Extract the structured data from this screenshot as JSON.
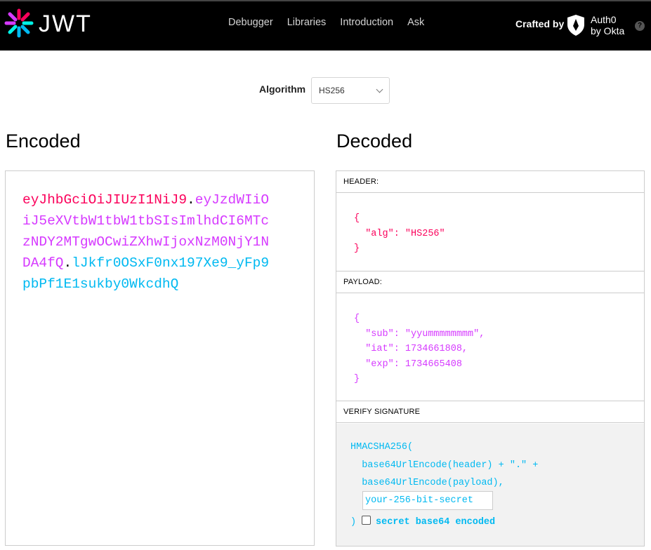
{
  "header": {
    "logo_text": "JWT",
    "nav": [
      {
        "label": "Debugger"
      },
      {
        "label": "Libraries"
      },
      {
        "label": "Introduction"
      },
      {
        "label": "Ask"
      }
    ],
    "crafted_by": "Crafted by",
    "auth0_line1": "Auth0",
    "auth0_line2": "by Okta",
    "help": "?"
  },
  "algorithm": {
    "label": "Algorithm",
    "selected": "HS256"
  },
  "encoded": {
    "title": "Encoded",
    "header_part": "eyJhbGciOiJIUzI1NiJ9",
    "payload_part": "eyJzdWIiOiJ5eXVtbW1tbW1tbSIsImlhdCI6MTczNDY2MTgwOCwiZXhwIjoxNzM0NjY1NDA4fQ",
    "signature_part": "lJkfr0OSxF0nx197Xe9_yFp9pbPf1E1sukby0WkcdhQ",
    "dot": "."
  },
  "decoded": {
    "title": "Decoded",
    "header_label": "HEADER:",
    "header_lines": [
      "{",
      "  \"alg\": \"HS256\"",
      "}"
    ],
    "payload_label": "PAYLOAD:",
    "payload_lines": [
      "{",
      "  \"sub\": \"yyummmmmmmm\",",
      "  \"iat\": 1734661808,",
      "  \"exp\": 1734665408",
      "}"
    ],
    "verify_label": "VERIFY SIGNATURE",
    "verify_lines": [
      "HMACSHA256(",
      "  base64UrlEncode(header) + \".\" +",
      "  base64UrlEncode(payload),"
    ],
    "secret_placeholder": "your-256-bit-secret",
    "close_paren": ")",
    "base64_label": "secret base64 encoded"
  },
  "colors": {
    "header": "#fb015b",
    "payload": "#d63aff",
    "signature": "#00b9f1"
  }
}
